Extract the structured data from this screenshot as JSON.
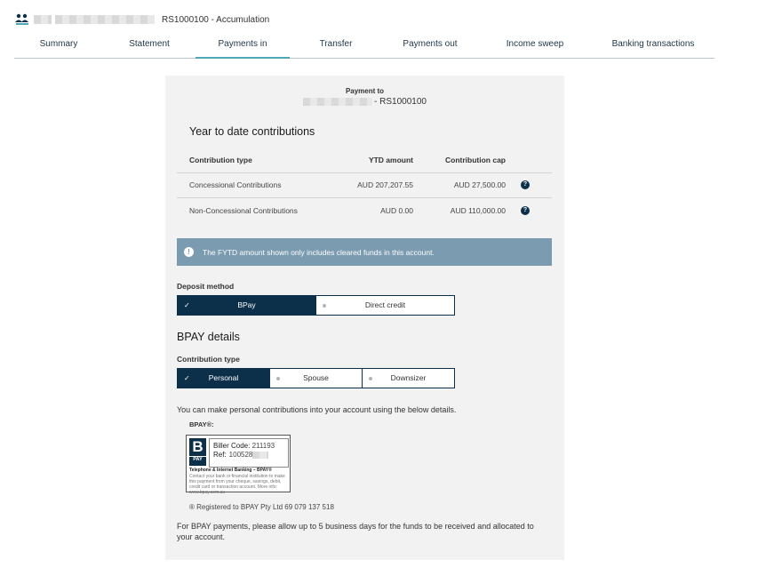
{
  "header": {
    "account_title": "RS1000100 - Accumulation",
    "icon": "users-icon"
  },
  "tabs": [
    {
      "label": "Summary"
    },
    {
      "label": "Statement"
    },
    {
      "label": "Payments in",
      "active": true
    },
    {
      "label": "Transfer"
    },
    {
      "label": "Payments out"
    },
    {
      "label": "Income sweep"
    },
    {
      "label": "Banking transactions"
    }
  ],
  "payment_to": {
    "label": "Payment to",
    "value_suffix": "- RS1000100"
  },
  "ytd": {
    "title": "Year to date contributions",
    "columns": {
      "type": "Contribution type",
      "amount": "YTD amount",
      "cap": "Contribution cap"
    },
    "rows": [
      {
        "type": "Concessional Contributions",
        "amount": "AUD 207,207.55",
        "cap": "AUD 27,500.00"
      },
      {
        "type": "Non-Concessional Contributions",
        "amount": "AUD 0.00",
        "cap": "AUD 110,000.00"
      }
    ]
  },
  "info_banner": {
    "text": "The FYTD amount shown only includes cleared funds in this account."
  },
  "deposit_method": {
    "label": "Deposit method",
    "options": [
      {
        "label": "BPay",
        "selected": true
      },
      {
        "label": "Direct credit",
        "selected": false
      }
    ]
  },
  "bpay_details": {
    "title": "BPAY details",
    "contribution_type_label": "Contribution type",
    "options": [
      {
        "label": "Personal",
        "selected": true
      },
      {
        "label": "Spouse",
        "selected": false
      },
      {
        "label": "Downsizer",
        "selected": false
      }
    ],
    "intro": "You can make personal contributions into your account using the below details.",
    "bpay_heading": "BPAY®:",
    "biller_code_label": "Biller Code:",
    "biller_code": "211193",
    "ref_label": "Ref:",
    "ref": "100528",
    "box_line1": "Telephone & Internet Banking – BPAY®",
    "box_line2": "Contact your bank or financial institution to make this payment from your cheque, savings, debit, credit card or transaction account. More info: www.bpay.com.au",
    "registered": "® Registered to BPAY Pty Ltd 69 079 137 518",
    "footer_note": "For BPAY payments, please allow up to 5 business days for the funds to be received and allocated to your account."
  },
  "colors": {
    "navy": "#0c2f4a",
    "accent": "#4fa7b8",
    "banner": "#7a9bb0"
  }
}
